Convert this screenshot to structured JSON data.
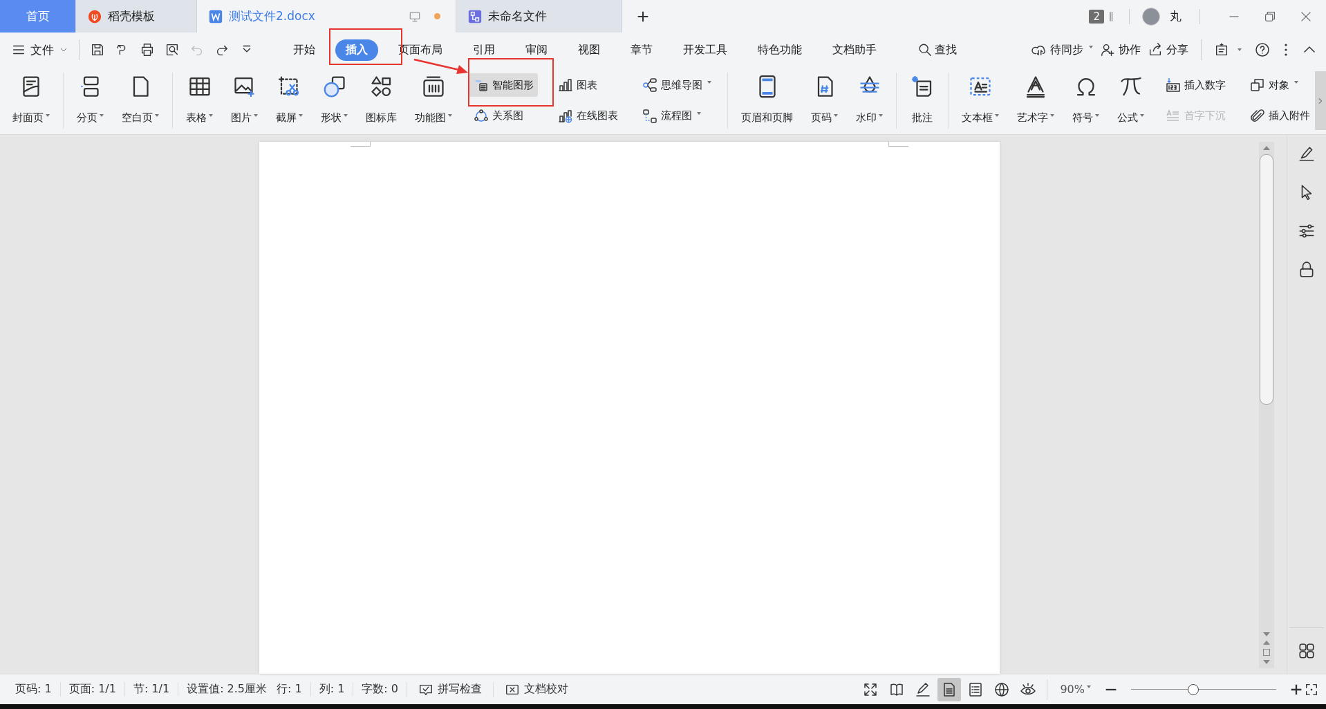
{
  "tabs": [
    {
      "label": "首页",
      "kind": "home",
      "selected": false,
      "unsaved": false
    },
    {
      "label": "稻壳模板",
      "kind": "template",
      "selected": false,
      "unsaved": false
    },
    {
      "label": "测试文件2.docx",
      "kind": "document",
      "selected": true,
      "unsaved": true
    },
    {
      "label": "未命名文件",
      "kind": "flowchart",
      "selected": false,
      "unsaved": false
    }
  ],
  "account": {
    "window_count": "2",
    "user": "丸"
  },
  "menu": {
    "file": "文件",
    "tabs": [
      {
        "label": "开始",
        "selected": false
      },
      {
        "label": "插入",
        "selected": true
      },
      {
        "label": "页面布局",
        "selected": false
      },
      {
        "label": "引用",
        "selected": false
      },
      {
        "label": "审阅",
        "selected": false
      },
      {
        "label": "视图",
        "selected": false
      },
      {
        "label": "章节",
        "selected": false
      },
      {
        "label": "开发工具",
        "selected": false
      },
      {
        "label": "特色功能",
        "selected": false
      },
      {
        "label": "文档助手",
        "selected": false
      }
    ],
    "search": "查找",
    "actions": [
      {
        "label": "待同步",
        "has_menu": true
      },
      {
        "label": "协作",
        "has_menu": false
      },
      {
        "label": "分享",
        "has_menu": false
      }
    ]
  },
  "ribbon": [
    {
      "items": [
        {
          "kind": "large",
          "label": "封面页",
          "has_menu": true
        }
      ]
    },
    {
      "items": [
        {
          "kind": "large",
          "label": "分页",
          "has_menu": true
        },
        {
          "kind": "large",
          "label": "空白页",
          "has_menu": true
        }
      ]
    },
    {
      "items": [
        {
          "kind": "large",
          "label": "表格",
          "has_menu": true
        },
        {
          "kind": "large",
          "label": "图片",
          "has_menu": true
        },
        {
          "kind": "large",
          "label": "截屏",
          "has_menu": true
        },
        {
          "kind": "large",
          "label": "形状",
          "has_menu": true
        },
        {
          "kind": "large",
          "label": "图标库",
          "has_menu": false
        },
        {
          "kind": "large",
          "label": "功能图",
          "has_menu": true
        },
        {
          "kind": "stack",
          "items": [
            {
              "label": "智能图形",
              "has_menu": false,
              "selected": true,
              "disabled": false
            },
            {
              "label": "关系图",
              "has_menu": false,
              "selected": false,
              "disabled": false
            }
          ]
        },
        {
          "kind": "stack",
          "items": [
            {
              "label": "图表",
              "has_menu": false,
              "selected": false,
              "disabled": false
            },
            {
              "label": "在线图表",
              "has_menu": false,
              "selected": false,
              "disabled": false
            }
          ]
        },
        {
          "kind": "stack",
          "items": [
            {
              "label": "思维导图",
              "has_menu": true,
              "selected": false,
              "disabled": false
            },
            {
              "label": "流程图",
              "has_menu": true,
              "selected": false,
              "disabled": false
            }
          ]
        }
      ]
    },
    {
      "items": [
        {
          "kind": "large",
          "label": "页眉和页脚",
          "has_menu": false
        },
        {
          "kind": "large",
          "label": "页码",
          "has_menu": true
        },
        {
          "kind": "large",
          "label": "水印",
          "has_menu": true
        }
      ]
    },
    {
      "items": [
        {
          "kind": "large",
          "label": "批注",
          "has_menu": false
        }
      ]
    },
    {
      "items": [
        {
          "kind": "large",
          "label": "文本框",
          "has_menu": true
        },
        {
          "kind": "large",
          "label": "艺术字",
          "has_menu": true
        },
        {
          "kind": "large",
          "label": "符号",
          "has_menu": true
        },
        {
          "kind": "large",
          "label": "公式",
          "has_menu": true
        },
        {
          "kind": "stack",
          "items": [
            {
              "label": "插入数字",
              "has_menu": false,
              "selected": false,
              "disabled": false
            },
            {
              "label": "首字下沉",
              "has_menu": false,
              "selected": false,
              "disabled": true
            }
          ]
        },
        {
          "kind": "stack",
          "items": [
            {
              "label": "对象",
              "has_menu": true,
              "selected": false,
              "disabled": false
            },
            {
              "label": "插入附件",
              "has_menu": false,
              "selected": false,
              "disabled": false
            }
          ]
        }
      ]
    }
  ],
  "status_bar": {
    "items": [
      "页码: 1",
      "页面: 1/1",
      "节: 1/1",
      "设置值: 2.5厘米",
      "行: 1",
      "列: 1",
      "字数: 0"
    ],
    "buttons": [
      "拼写检查",
      "文档校对"
    ],
    "view_modes": [
      {
        "selected": false
      },
      {
        "selected": false
      },
      {
        "selected": false
      },
      {
        "selected": true
      },
      {
        "selected": false
      },
      {
        "selected": false
      },
      {
        "selected": false
      }
    ],
    "zoom": "90%",
    "zoom_slider": {
      "level": 0.43
    }
  }
}
